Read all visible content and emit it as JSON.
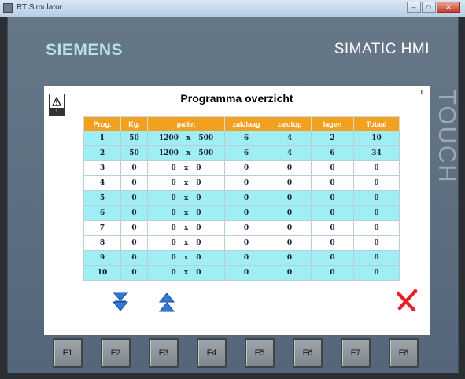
{
  "window": {
    "title": "RT Simulator",
    "min": "–",
    "max": "□",
    "close": "✕"
  },
  "panel": {
    "brand": "SIEMENS",
    "model": "SIMATIC HMI",
    "touch": "TOUCH"
  },
  "screen": {
    "title": "Programma overzicht",
    "page_num": "8",
    "alarm_count": "1",
    "columns": [
      "Prog.",
      "Kg.",
      "pallet",
      "zak/laag",
      "zak/top",
      "lagen",
      "Totaal"
    ],
    "rows": [
      {
        "prog": "1",
        "kg": "50",
        "pal_a": "1200",
        "x": "x",
        "pal_b": "500",
        "zak_laag": "6",
        "zak_top": "4",
        "lagen": "2",
        "totaal": "10"
      },
      {
        "prog": "2",
        "kg": "50",
        "pal_a": "1200",
        "x": "x",
        "pal_b": "500",
        "zak_laag": "6",
        "zak_top": "4",
        "lagen": "6",
        "totaal": "34"
      },
      {
        "prog": "3",
        "kg": "0",
        "pal_a": "0",
        "x": "x",
        "pal_b": "0",
        "zak_laag": "0",
        "zak_top": "0",
        "lagen": "0",
        "totaal": "0"
      },
      {
        "prog": "4",
        "kg": "0",
        "pal_a": "0",
        "x": "x",
        "pal_b": "0",
        "zak_laag": "0",
        "zak_top": "0",
        "lagen": "0",
        "totaal": "0"
      },
      {
        "prog": "5",
        "kg": "0",
        "pal_a": "0",
        "x": "x",
        "pal_b": "0",
        "zak_laag": "0",
        "zak_top": "0",
        "lagen": "0",
        "totaal": "0"
      },
      {
        "prog": "6",
        "kg": "0",
        "pal_a": "0",
        "x": "x",
        "pal_b": "0",
        "zak_laag": "0",
        "zak_top": "0",
        "lagen": "0",
        "totaal": "0"
      },
      {
        "prog": "7",
        "kg": "0",
        "pal_a": "0",
        "x": "x",
        "pal_b": "0",
        "zak_laag": "0",
        "zak_top": "0",
        "lagen": "0",
        "totaal": "0"
      },
      {
        "prog": "8",
        "kg": "0",
        "pal_a": "0",
        "x": "x",
        "pal_b": "0",
        "zak_laag": "0",
        "zak_top": "0",
        "lagen": "0",
        "totaal": "0"
      },
      {
        "prog": "9",
        "kg": "0",
        "pal_a": "0",
        "x": "x",
        "pal_b": "0",
        "zak_laag": "0",
        "zak_top": "0",
        "lagen": "0",
        "totaal": "0"
      },
      {
        "prog": "10",
        "kg": "0",
        "pal_a": "0",
        "x": "x",
        "pal_b": "0",
        "zak_laag": "0",
        "zak_top": "0",
        "lagen": "0",
        "totaal": "0"
      }
    ],
    "icons": {
      "alarm": "warning-triangle-icon",
      "scroll_down": "double-chevron-down-icon",
      "scroll_up": "double-chevron-up-icon",
      "close": "red-x-icon"
    },
    "colors": {
      "header": "#f2a020",
      "row_cyan": "#9eeef3",
      "row_white": "#ffffff",
      "close": "#e8202a",
      "nav": "#2d7ad8"
    }
  },
  "function_keys": [
    "F1",
    "F2",
    "F3",
    "F4",
    "F5",
    "F6",
    "F7",
    "F8"
  ]
}
